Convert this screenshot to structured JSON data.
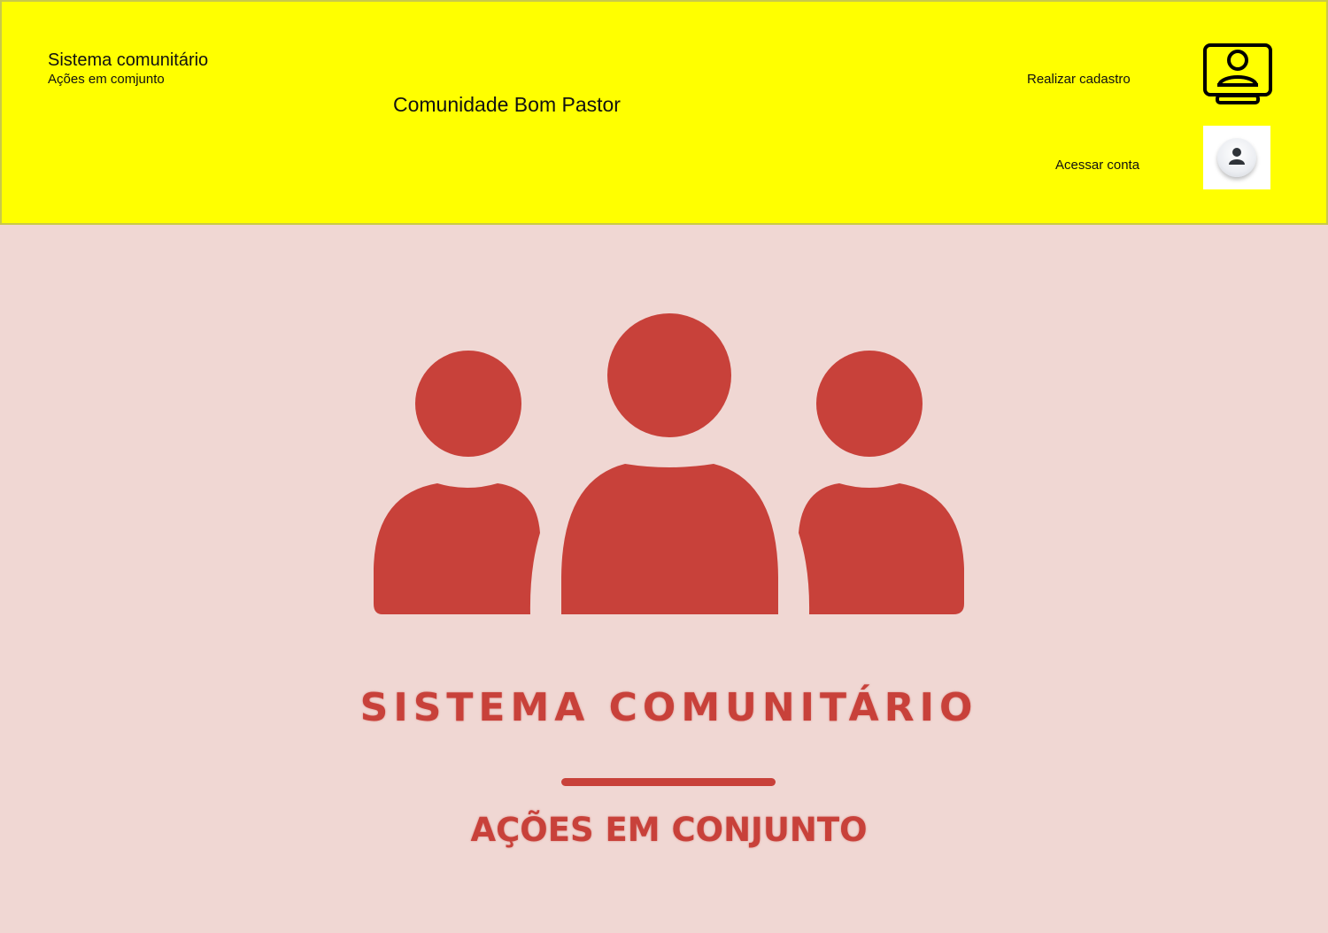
{
  "header": {
    "brand_title": "Sistema comunitário",
    "brand_subtitle": "Ações em comjunto",
    "community_name": "Comunidade Bom Pastor",
    "register_label": "Realizar cadastro",
    "login_label": "Acessar conta",
    "register_icon": "user-monitor-icon",
    "login_icon": "user-avatar-icon"
  },
  "hero": {
    "logo_icon": "people-group-icon",
    "title": "SISTEMA COMUNITÁRIO",
    "subtitle": "AÇÕES EM CONJUNTO"
  },
  "colors": {
    "header_background": "#ffff00",
    "page_background": "#f0d7d3",
    "accent": "#c8413a"
  }
}
